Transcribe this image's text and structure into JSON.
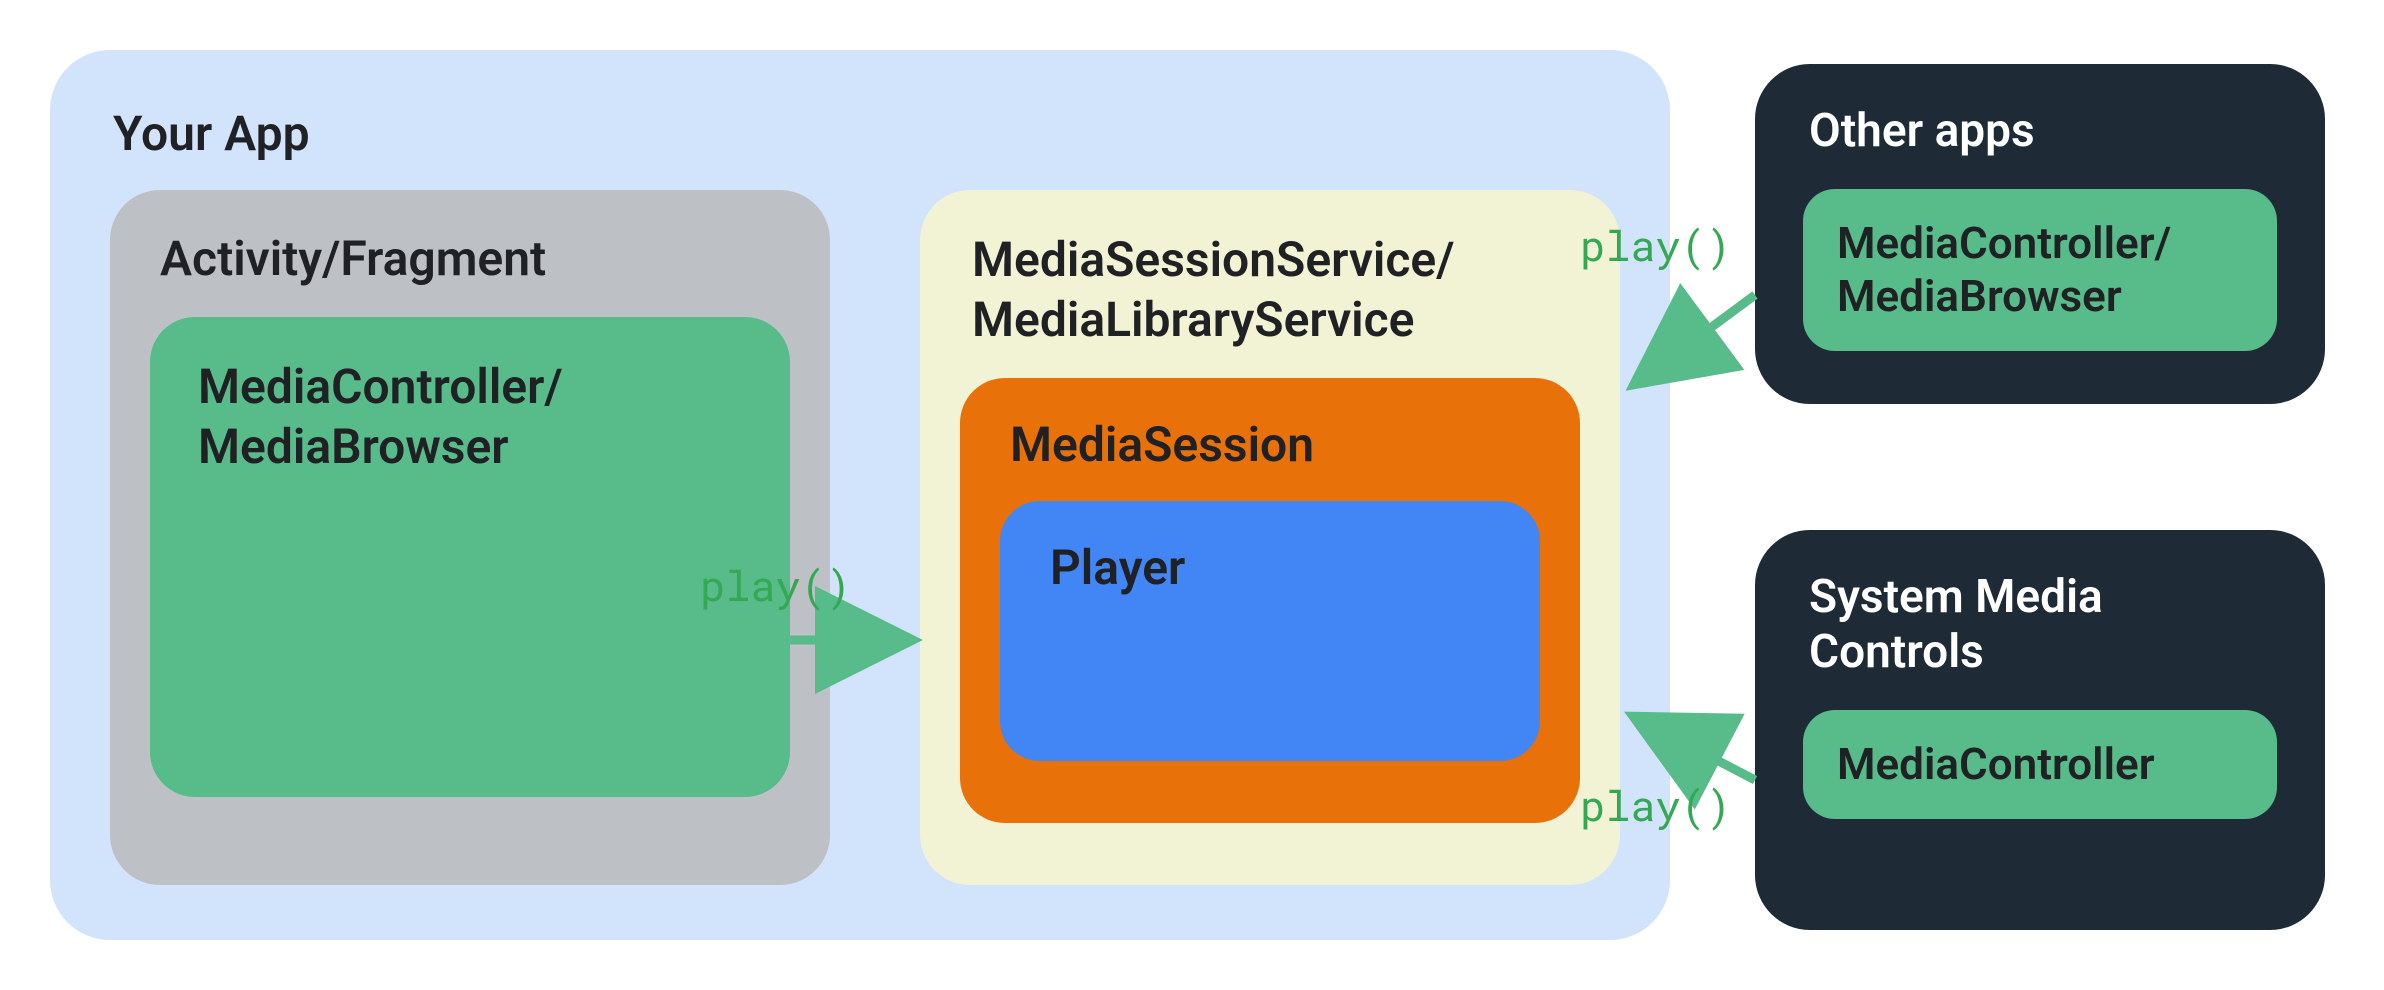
{
  "colors": {
    "light_blue": "#d2e3fc",
    "gray": "#bdc1c6",
    "green": "#57bb8a",
    "yellow": "#f1f3d4",
    "orange": "#e8710a",
    "blue": "#4285f4",
    "navy": "#1f2a37",
    "arrow_green": "#34a853"
  },
  "your_app": {
    "title": "Your App"
  },
  "activity": {
    "title": "Activity/Fragment",
    "controller_label": "MediaController/\nMediaBrowser"
  },
  "service": {
    "title": "MediaSessionService/\nMediaLibraryService",
    "media_session": "MediaSession",
    "player": "Player"
  },
  "other_apps": {
    "title": "Other apps",
    "controller_label": "MediaController/\nMediaBrowser"
  },
  "system_controls": {
    "title": "System Media\nControls",
    "controller_label": "MediaController"
  },
  "arrows": {
    "label_1": "play()",
    "label_2": "play()",
    "label_3": "play()"
  }
}
